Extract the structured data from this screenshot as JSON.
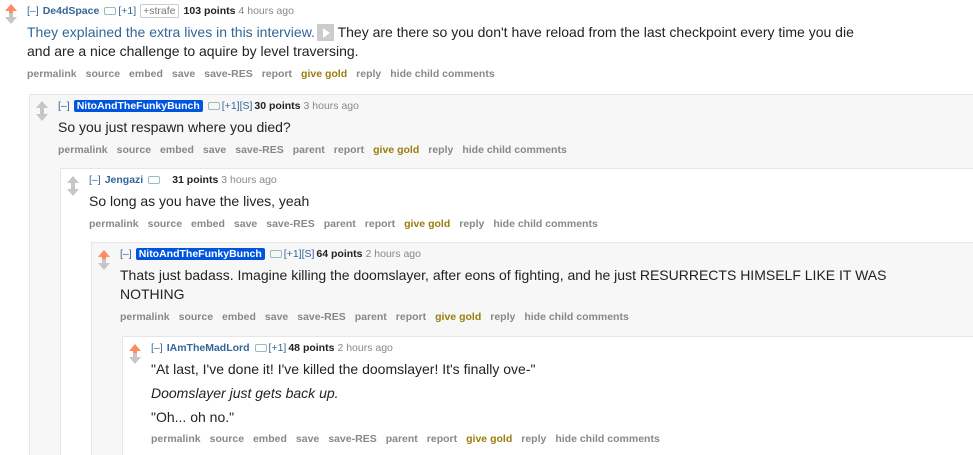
{
  "comments": [
    {
      "expand": "[–]",
      "author": "De4dSpace",
      "res_tag": "[+1]",
      "strafe": "+strafe",
      "score": "103 points",
      "time": "4 hours ago",
      "link_text": "They explained the extra lives in this interview.",
      "body_rest": " They are there so you don't have reload from the last checkpoint every time you die and are a nice challenge to aquire by level traversing.",
      "buttons": [
        "permalink",
        "source",
        "embed",
        "save",
        "save-RES",
        "report",
        "give gold",
        "reply",
        "hide child comments"
      ]
    },
    {
      "expand": "[–]",
      "author": "NitoAndTheFunkyBunch",
      "res_tag": "[+1][S]",
      "score": "30 points",
      "time": "3 hours ago",
      "body": "So you just respawn where you died?",
      "buttons": [
        "permalink",
        "source",
        "embed",
        "save",
        "save-RES",
        "parent",
        "report",
        "give gold",
        "reply",
        "hide child comments"
      ]
    },
    {
      "expand": "[–]",
      "author": "Jengazi",
      "res_tag": "",
      "score": "31 points",
      "time": "3 hours ago",
      "body": "So long as you have the lives, yeah",
      "buttons": [
        "permalink",
        "source",
        "embed",
        "save",
        "save-RES",
        "parent",
        "report",
        "give gold",
        "reply",
        "hide child comments"
      ]
    },
    {
      "expand": "[–]",
      "author": "NitoAndTheFunkyBunch",
      "res_tag": "[+1][S]",
      "score": "64 points",
      "time": "2 hours ago",
      "body": "Thats just badass. Imagine killing the doomslayer, after eons of fighting, and he just RESURRECTS HIMSELF LIKE IT WAS NOTHING",
      "buttons": [
        "permalink",
        "source",
        "embed",
        "save",
        "save-RES",
        "parent",
        "report",
        "give gold",
        "reply",
        "hide child comments"
      ]
    },
    {
      "expand": "[–]",
      "author": "IAmTheMadLord",
      "res_tag": "[+1]",
      "score": "48 points",
      "time": "2 hours ago",
      "body_lines": [
        "\"At last, I've done it! I've killed the doomslayer! It's finally ove-\"",
        "Doomslayer just gets back up.",
        "\"Oh... oh no.\""
      ],
      "buttons": [
        "permalink",
        "source",
        "embed",
        "save",
        "save-RES",
        "parent",
        "report",
        "give gold",
        "reply",
        "hide child comments"
      ]
    }
  ],
  "colors": {
    "link": "#336699",
    "flair_bg": "#0055df",
    "upvote": "#ff8b60",
    "gold": "#9a7d0a"
  }
}
